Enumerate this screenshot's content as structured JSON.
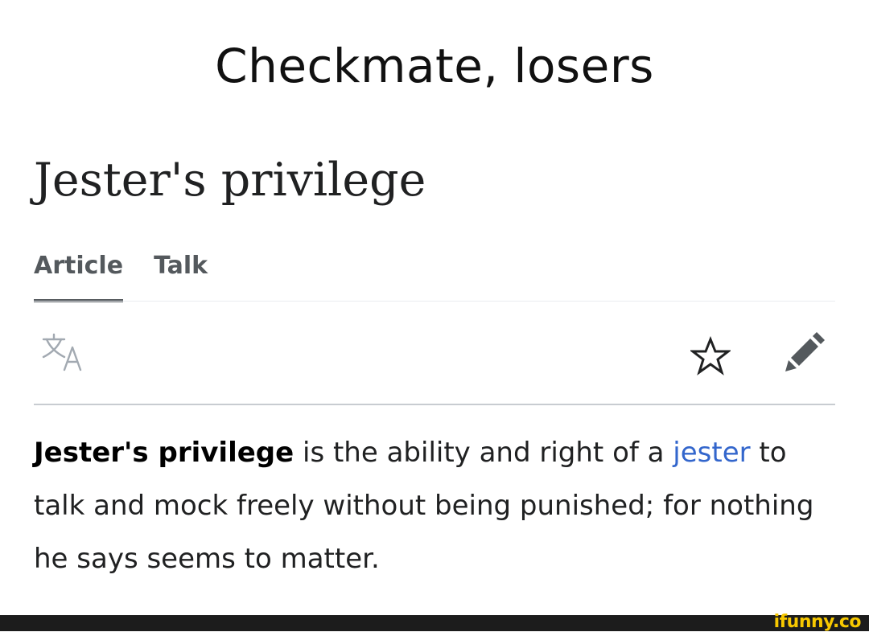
{
  "meme_caption": "Checkmate, losers",
  "article": {
    "title": "Jester's privilege",
    "tabs": [
      {
        "label": "Article",
        "active": true
      },
      {
        "label": "Talk",
        "active": false
      }
    ],
    "toolbar": {
      "language_icon": "translate-icon",
      "watch_icon": "star-icon",
      "edit_icon": "pencil-icon"
    },
    "lead": {
      "term": "Jester's privilege",
      "text_before_link": " is the ability and right of a ",
      "link_text": "jester",
      "text_after_link": " to talk and mock freely without being punished; for nothing he says seems to matter."
    }
  },
  "watermark": "ifunny.co",
  "colors": {
    "link": "#3366cc",
    "tab_text": "#54595d",
    "icon_gray": "#54595d",
    "watermark": "#f7c800",
    "footer_bar": "#1c1c1c"
  }
}
